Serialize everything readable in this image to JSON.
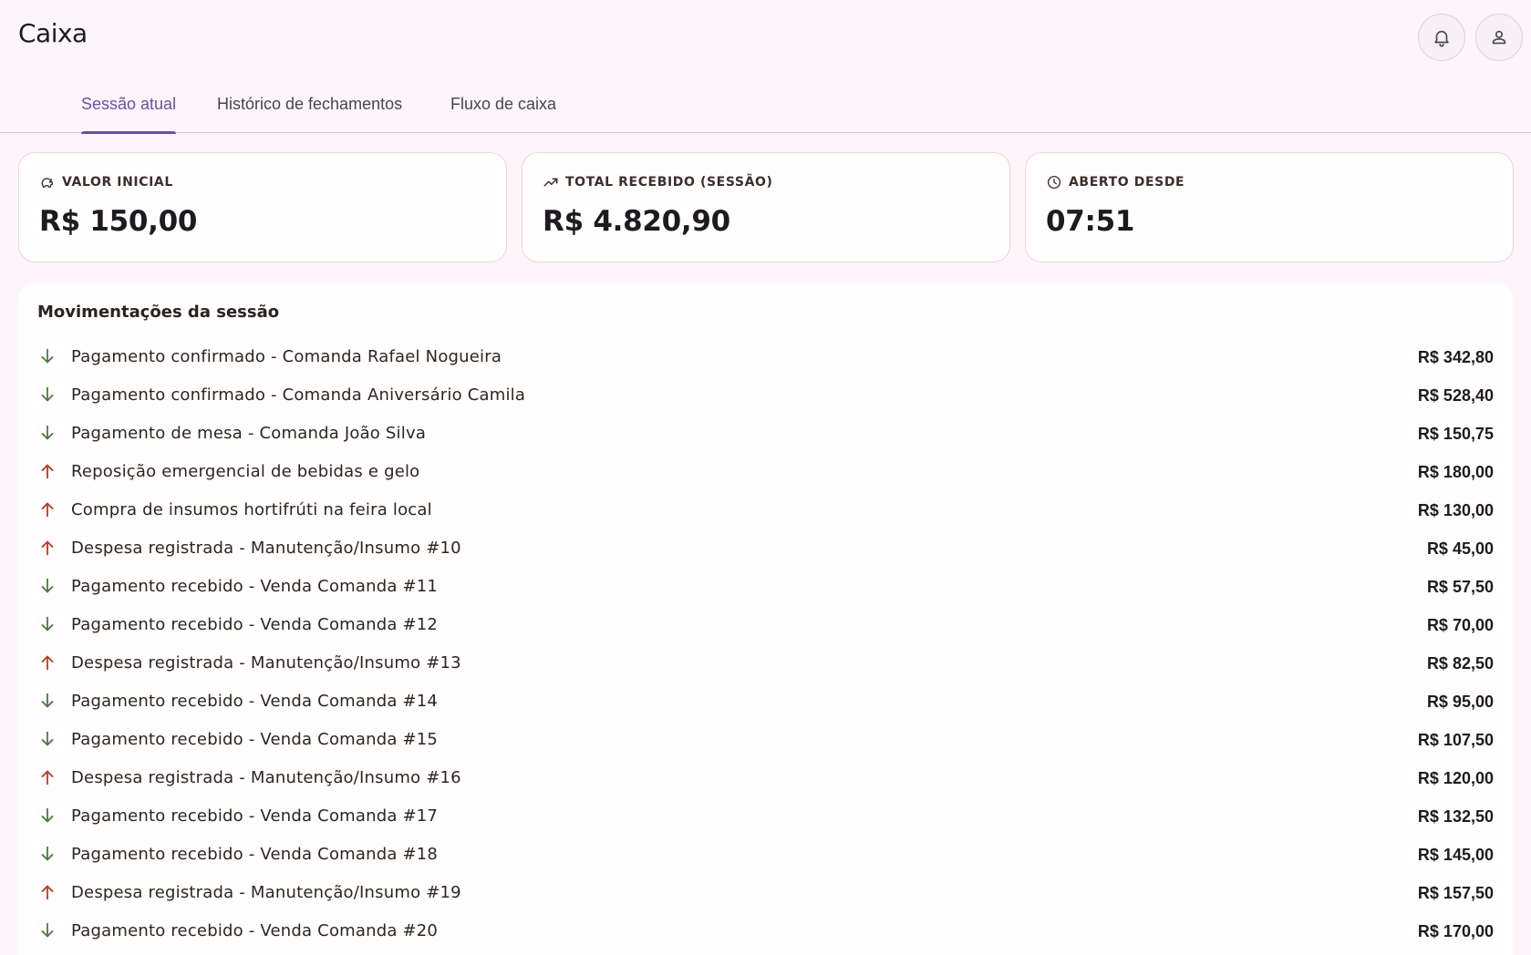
{
  "header": {
    "title": "Caixa",
    "notifications_icon": "bell-icon",
    "account_icon": "person-icon"
  },
  "tabs": [
    {
      "label": "Sessão atual",
      "active": true
    },
    {
      "label": "Histórico de fechamentos",
      "active": false
    },
    {
      "label": "Fluxo de caixa",
      "active": false
    }
  ],
  "cards": [
    {
      "icon": "piggy-bank-icon",
      "label": "VALOR INICIAL",
      "value": "R$ 150,00"
    },
    {
      "icon": "trending-up-icon",
      "label": "TOTAL RECEBIDO (SESSÃO)",
      "value": "R$ 4.820,90"
    },
    {
      "icon": "clock-icon",
      "label": "ABERTO DESDE",
      "value": "07:51"
    }
  ],
  "movements": {
    "title": "Movimentações da sessão",
    "items": [
      {
        "type": "in",
        "description": "Pagamento confirmado - Comanda Rafael Nogueira",
        "amount": "R$ 342,80"
      },
      {
        "type": "in",
        "description": "Pagamento confirmado - Comanda Aniversário Camila",
        "amount": "R$ 528,40"
      },
      {
        "type": "in",
        "description": "Pagamento de mesa - Comanda João Silva",
        "amount": "R$ 150,75"
      },
      {
        "type": "out",
        "description": "Reposição emergencial de bebidas e gelo",
        "amount": "R$ 180,00"
      },
      {
        "type": "out",
        "description": "Compra de insumos hortifrúti na feira local",
        "amount": "R$ 130,00"
      },
      {
        "type": "out",
        "description": "Despesa registrada - Manutenção/Insumo #10",
        "amount": "R$ 45,00"
      },
      {
        "type": "in",
        "description": "Pagamento recebido - Venda Comanda #11",
        "amount": "R$ 57,50"
      },
      {
        "type": "in",
        "description": "Pagamento recebido - Venda Comanda #12",
        "amount": "R$ 70,00"
      },
      {
        "type": "out",
        "description": "Despesa registrada - Manutenção/Insumo #13",
        "amount": "R$ 82,50"
      },
      {
        "type": "in",
        "description": "Pagamento recebido - Venda Comanda #14",
        "amount": "R$ 95,00"
      },
      {
        "type": "in",
        "description": "Pagamento recebido - Venda Comanda #15",
        "amount": "R$ 107,50"
      },
      {
        "type": "out",
        "description": "Despesa registrada - Manutenção/Insumo #16",
        "amount": "R$ 120,00"
      },
      {
        "type": "in",
        "description": "Pagamento recebido - Venda Comanda #17",
        "amount": "R$ 132,50"
      },
      {
        "type": "in",
        "description": "Pagamento recebido - Venda Comanda #18",
        "amount": "R$ 145,00"
      },
      {
        "type": "out",
        "description": "Despesa registrada - Manutenção/Insumo #19",
        "amount": "R$ 157,50"
      },
      {
        "type": "in",
        "description": "Pagamento recebido - Venda Comanda #20",
        "amount": "R$ 170,00"
      }
    ]
  },
  "colors": {
    "accent": "#6750a4",
    "incoming": "#4f7a4a",
    "outgoing": "#b3402a",
    "background": "#fcf6fb"
  }
}
